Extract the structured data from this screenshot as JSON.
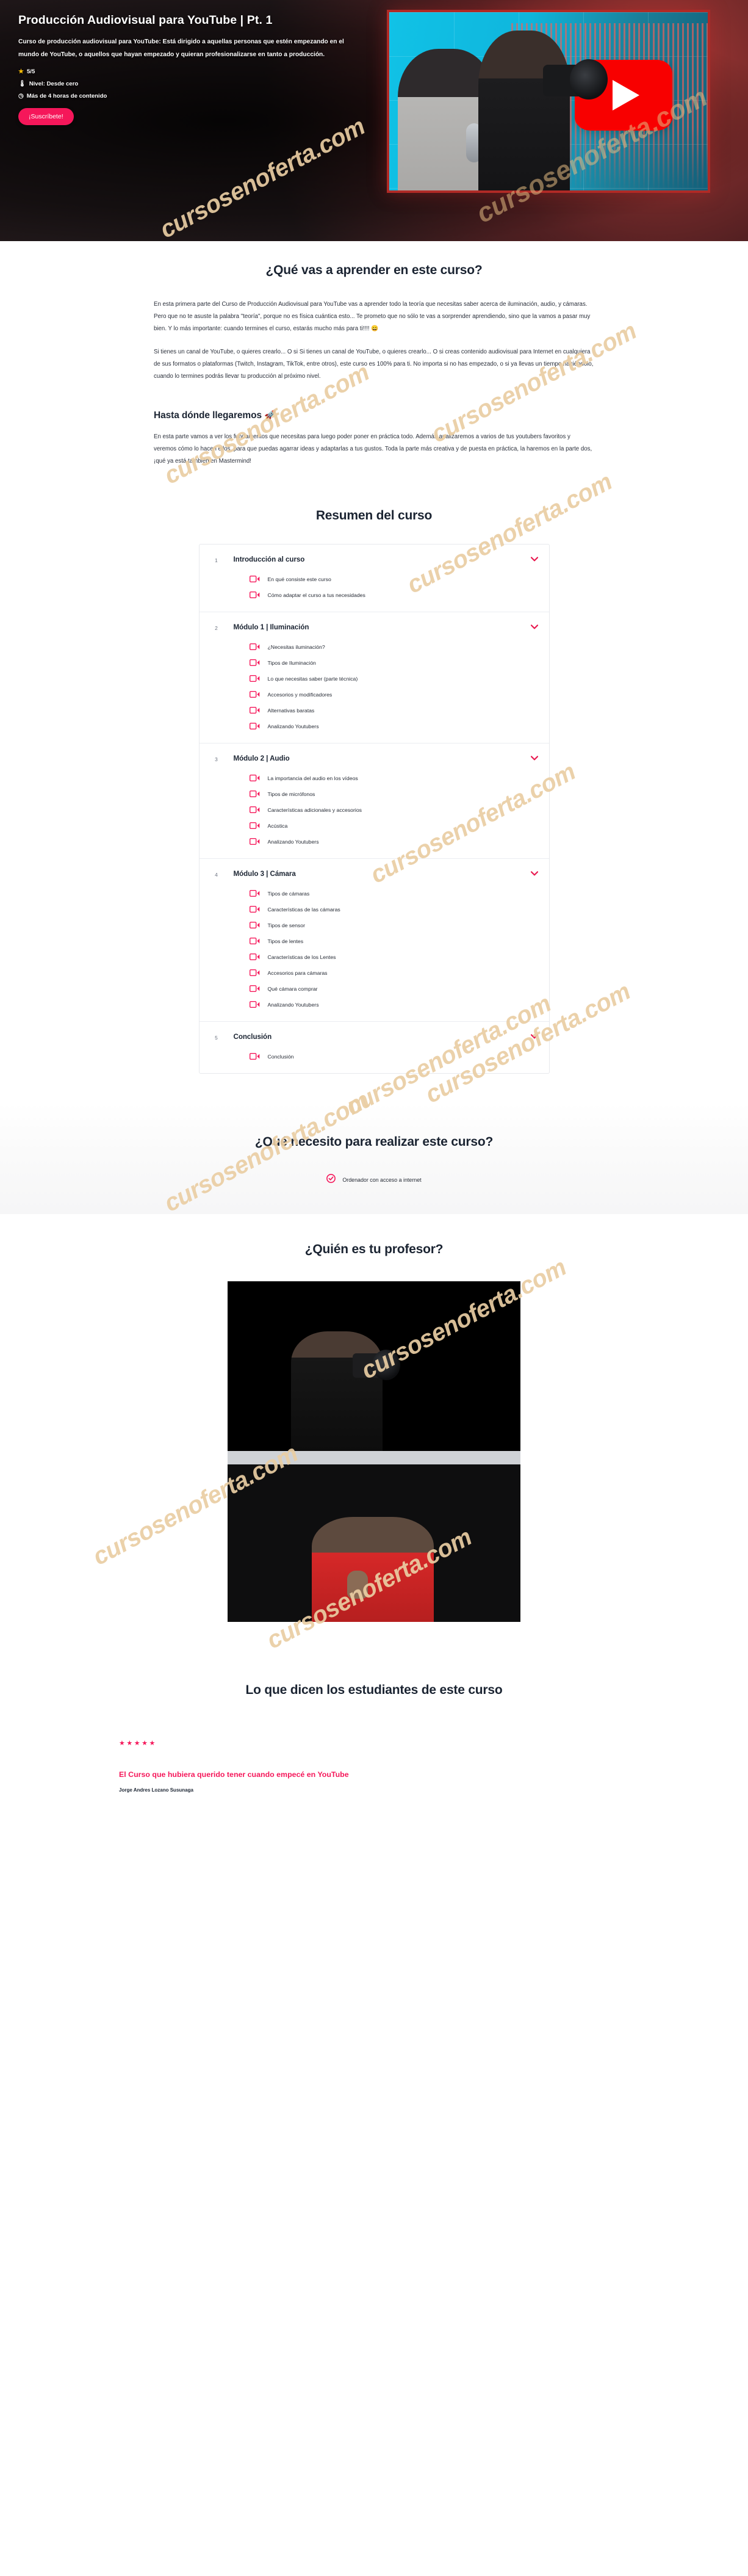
{
  "hero": {
    "title": "Producción Audiovisual para YouTube | Pt. 1",
    "description": "Curso de producción audiovisual para YouTube: Está dirigido a aquellas personas que estén empezando en el mundo de YouTube, o aquellos que hayan empezado y quieran profesionalizarse en tanto a producción.",
    "rating": "5/5",
    "level": "Nivel: Desde cero",
    "duration": "Más de 4 horas de contenido",
    "cta": "¡Suscríbete!",
    "accent": "#f5175a",
    "icons": {
      "star": "star-icon",
      "level": "thermometer-icon",
      "clock": "clock-icon"
    }
  },
  "learn": {
    "heading": "¿Qué vas a aprender en este curso?",
    "paragraph_1": "En esta primera parte del Curso de Producción Audiovisual para YouTube vas a aprender todo la teoría que necesitas saber acerca de iluminación, audio, y cámaras. Pero que no te asuste la palabra \"teoría\", porque no es física cuántica esto... Te prometo que no sólo te vas a sorprender aprendiendo, sino que la vamos a pasar muy bien. Y lo más importante: cuando termines el curso, estarás mucho más para ti!!!! 😄",
    "paragraph_2": "Si tienes un canal de YouTube, o quieres crearlo... O si Si tienes un canal de YouTube, o quieres crearlo... O si creas contenido audiovisual para Internet en cualquiera de sus formatos o plataformas (Twitch, Instagram, TikTok, entre otros), este curso es 100% para ti. No importa si no has empezado, o si ya llevas un tiempo haciéndolo, cuando lo termines podrás llevar tu producción al próximo nivel.",
    "sub_heading": "Hasta dónde llegaremos 🚀",
    "sub_paragraph": "En esta parte vamos a ver los fundamentos que necesitas para luego poder poner en práctica todo. Además analizaremos a varios de tus youtubers favoritos y veremos cómo lo hacen ellos, para que puedas agarrar ideas y adaptarlas a tus gustos. Toda la parte más creativa y de puesta en práctica, la haremos en la parte dos, ¡qué ya está también en Mastermind!"
  },
  "curriculum": {
    "heading": "Resumen del curso",
    "modules": [
      {
        "number": "1",
        "title": "Introducción al curso",
        "lessons": [
          "En qué consiste este curso",
          "Cómo adaptar el curso a tus necesidades"
        ]
      },
      {
        "number": "2",
        "title": "Módulo 1 | Iluminación",
        "lessons": [
          "¿Necesitas iluminación?",
          "Tipos de Iluminación",
          "Lo que necesitas saber (parte técnica)",
          "Accesorios y modificadores",
          "Alternativas baratas",
          "Analizando Youtubers"
        ]
      },
      {
        "number": "3",
        "title": "Módulo 2 | Audio",
        "lessons": [
          "La importancia del audio en los vídeos",
          "Tipos de micrófonos",
          "Características adicionales y accesorios",
          "Acústica",
          "Analizando Youtubers"
        ]
      },
      {
        "number": "4",
        "title": "Módulo 3 | Cámara",
        "lessons": [
          "Tipos de cámaras",
          "Características de las cámaras",
          "Tipos de sensor",
          "Tipos de lentes",
          "Características de los Lentes",
          "Accesorios para cámaras",
          "Qué cámara comprar",
          "Analizando Youtubers"
        ]
      },
      {
        "number": "5",
        "title": "Conclusión",
        "lessons": [
          "Conclusión"
        ]
      }
    ]
  },
  "requirements": {
    "heading": "¿Qué necesito para realizar este curso?",
    "items": [
      "Ordenador con acceso a internet"
    ]
  },
  "professor": {
    "heading": "¿Quién es tu profesor?"
  },
  "testimonials": {
    "heading": "Lo que dicen los estudiantes de este curso",
    "items": [
      {
        "stars": "★★★★★",
        "title": "El Curso que hubiera querido tener cuando empecé en YouTube",
        "author": "Jorge Andres Lozano Susunaga"
      }
    ]
  },
  "watermark": {
    "text": "cursosenoferta.com"
  }
}
